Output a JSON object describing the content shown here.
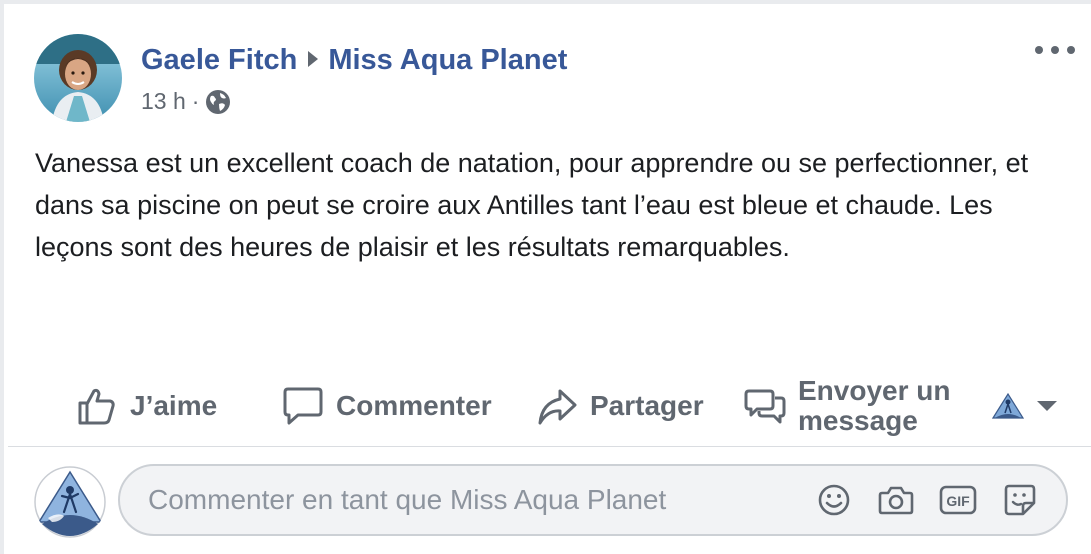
{
  "post": {
    "author": "Gaele Fitch",
    "page": "Miss Aqua Planet",
    "time": "13 h",
    "separator": "·",
    "privacy_icon": "globe-icon",
    "text": "Vanessa est un excellent coach de natation, pour apprendre ou se perfectionner, et dans sa piscine on peut se croire aux Antilles tant l’eau est bleue et chaude. Les leçons sont des heures de plaisir et les résultats remarquables."
  },
  "actions": {
    "like": "J’aime",
    "comment": "Commenter",
    "share": "Partager",
    "message_line1": "Envoyer un",
    "message_line2": "message"
  },
  "composer": {
    "placeholder": "Commenter en tant que Miss Aqua Planet",
    "value": "",
    "icons": [
      "emoji-icon",
      "camera-icon",
      "gif-icon",
      "sticker-icon"
    ]
  },
  "colors": {
    "link": "#385898",
    "secondary_text": "#606770",
    "background": "#e9ebee"
  }
}
